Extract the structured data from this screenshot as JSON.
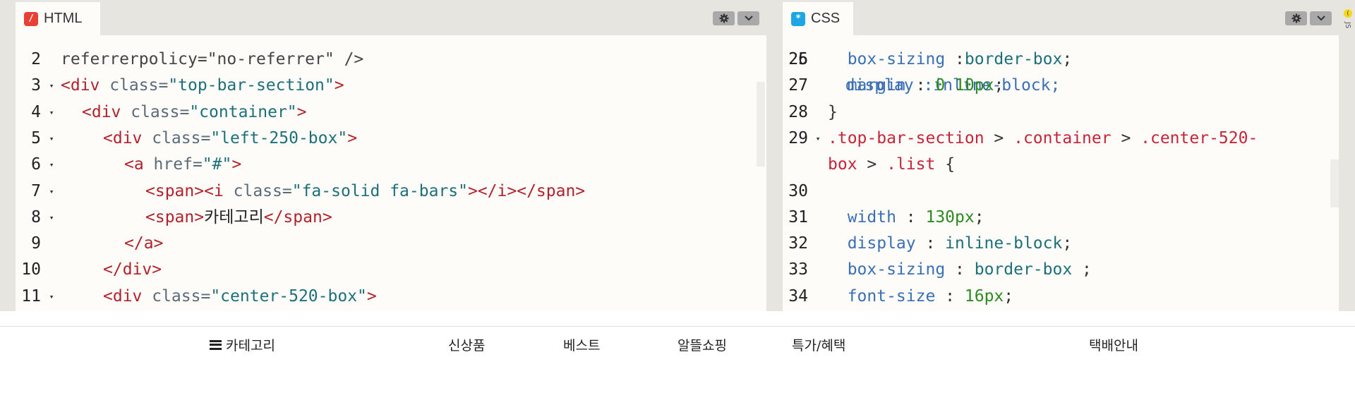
{
  "html_panel": {
    "tab_label": "HTML",
    "tab_icon": "html-slash-icon",
    "accent": "#e84034",
    "partial_top": "referrerpolicy=\"no-referrer\" />",
    "lines": [
      {
        "num": "2",
        "fold": false,
        "indent": 0,
        "tokens": []
      },
      {
        "num": "3",
        "fold": true,
        "indent": 0,
        "tokens": [
          {
            "c": "t-tag",
            "t": "<div"
          },
          {
            "c": "t-attr",
            "t": " class="
          },
          {
            "c": "t-str",
            "t": "\"top-bar-section\""
          },
          {
            "c": "t-tag",
            "t": ">"
          }
        ]
      },
      {
        "num": "4",
        "fold": true,
        "indent": 1,
        "tokens": [
          {
            "c": "t-tag",
            "t": "<div"
          },
          {
            "c": "t-attr",
            "t": " class="
          },
          {
            "c": "t-str",
            "t": "\"container\""
          },
          {
            "c": "t-tag",
            "t": ">"
          }
        ]
      },
      {
        "num": "5",
        "fold": true,
        "indent": 2,
        "tokens": [
          {
            "c": "t-tag",
            "t": "<div"
          },
          {
            "c": "t-attr",
            "t": " class="
          },
          {
            "c": "t-str",
            "t": "\"left-250-box\""
          },
          {
            "c": "t-tag",
            "t": ">"
          }
        ]
      },
      {
        "num": "6",
        "fold": true,
        "indent": 3,
        "tokens": [
          {
            "c": "t-tag",
            "t": "<a"
          },
          {
            "c": "t-attr",
            "t": " href="
          },
          {
            "c": "t-str",
            "t": "\"#\""
          },
          {
            "c": "t-tag",
            "t": ">"
          }
        ]
      },
      {
        "num": "7",
        "fold": true,
        "indent": 4,
        "tokens": [
          {
            "c": "t-tag",
            "t": "<span>"
          },
          {
            "c": "t-tag",
            "t": "<i"
          },
          {
            "c": "t-attr",
            "t": " class="
          },
          {
            "c": "t-str",
            "t": "\"fa-solid fa-bars\""
          },
          {
            "c": "t-tag",
            "t": "></i></span>"
          }
        ]
      },
      {
        "num": "8",
        "fold": true,
        "indent": 4,
        "tokens": [
          {
            "c": "t-tag",
            "t": "<span>"
          },
          {
            "c": "t-kr",
            "t": "카테고리"
          },
          {
            "c": "t-tag",
            "t": "</span>"
          }
        ]
      },
      {
        "num": "9",
        "fold": false,
        "indent": 3,
        "tokens": [
          {
            "c": "t-tag",
            "t": "</a>"
          }
        ]
      },
      {
        "num": "10",
        "fold": false,
        "indent": 2,
        "tokens": [
          {
            "c": "t-tag",
            "t": "</div>"
          }
        ]
      },
      {
        "num": "11",
        "fold": true,
        "indent": 2,
        "tokens": [
          {
            "c": "t-tag",
            "t": "<div"
          },
          {
            "c": "t-attr",
            "t": " class="
          },
          {
            "c": "t-str",
            "t": "\"center-520-box\""
          },
          {
            "c": "t-tag",
            "t": ">"
          }
        ]
      }
    ]
  },
  "css_panel": {
    "tab_label": "CSS",
    "tab_icon": "css-asterisk-icon",
    "accent": "#1ea5e3",
    "partial_top_num": "25",
    "partial_top": "  display :inline-block;",
    "lines": [
      {
        "num": "26",
        "fold": false,
        "tokens": [
          {
            "c": "t-prop",
            "t": "  box-sizing"
          },
          {
            "c": "t-plain",
            "t": " :"
          },
          {
            "c": "t-val",
            "t": "border-box"
          },
          {
            "c": "t-plain",
            "t": ";"
          }
        ]
      },
      {
        "num": "27",
        "fold": false,
        "tokens": [
          {
            "c": "t-prop",
            "t": "  margin"
          },
          {
            "c": "t-plain",
            "t": " : "
          },
          {
            "c": "t-num",
            "t": "0"
          },
          {
            "c": "t-plain",
            "t": " "
          },
          {
            "c": "t-num",
            "t": "10px"
          },
          {
            "c": "t-plain",
            "t": ";"
          }
        ]
      },
      {
        "num": "28",
        "fold": false,
        "tokens": [
          {
            "c": "t-plain",
            "t": "}"
          }
        ]
      },
      {
        "num": "29",
        "fold": true,
        "tokens": [
          {
            "c": "t-sel",
            "t": ".top-bar-section"
          },
          {
            "c": "t-plain",
            "t": " > "
          },
          {
            "c": "t-sel",
            "t": ".container"
          },
          {
            "c": "t-plain",
            "t": " > "
          },
          {
            "c": "t-sel",
            "t": ".center-520-"
          }
        ]
      },
      {
        "num": "",
        "fold": false,
        "tokens": [
          {
            "c": "t-sel",
            "t": "box"
          },
          {
            "c": "t-plain",
            "t": " > "
          },
          {
            "c": "t-sel",
            "t": ".list"
          },
          {
            "c": "t-plain",
            "t": " {"
          }
        ]
      },
      {
        "num": "30",
        "fold": false,
        "tokens": []
      },
      {
        "num": "31",
        "fold": false,
        "tokens": [
          {
            "c": "t-prop",
            "t": "  width"
          },
          {
            "c": "t-plain",
            "t": " : "
          },
          {
            "c": "t-num",
            "t": "130px"
          },
          {
            "c": "t-plain",
            "t": ";"
          }
        ]
      },
      {
        "num": "32",
        "fold": false,
        "tokens": [
          {
            "c": "t-prop",
            "t": "  display"
          },
          {
            "c": "t-plain",
            "t": " : "
          },
          {
            "c": "t-val",
            "t": "inline-block"
          },
          {
            "c": "t-plain",
            "t": ";"
          }
        ]
      },
      {
        "num": "33",
        "fold": false,
        "tokens": [
          {
            "c": "t-prop",
            "t": "  box-sizing"
          },
          {
            "c": "t-plain",
            "t": " : "
          },
          {
            "c": "t-val",
            "t": "border-box"
          },
          {
            "c": "t-plain",
            "t": " ;"
          }
        ]
      },
      {
        "num": "34",
        "fold": false,
        "tokens": [
          {
            "c": "t-prop",
            "t": "  font-size"
          },
          {
            "c": "t-plain",
            "t": " : "
          },
          {
            "c": "t-num",
            "t": "16px"
          },
          {
            "c": "t-plain",
            "t": ";"
          }
        ]
      }
    ]
  },
  "js_strip": {
    "label": "JS",
    "accent": "#f5d71c"
  },
  "preview": {
    "category_label": "카테고리",
    "category_icon": "bars-icon",
    "menu": [
      {
        "label": "신상품"
      },
      {
        "label": "베스트"
      },
      {
        "label": "알뜰쇼핑"
      },
      {
        "label": "특가/혜택"
      }
    ],
    "shipping_label": "택배안내"
  }
}
